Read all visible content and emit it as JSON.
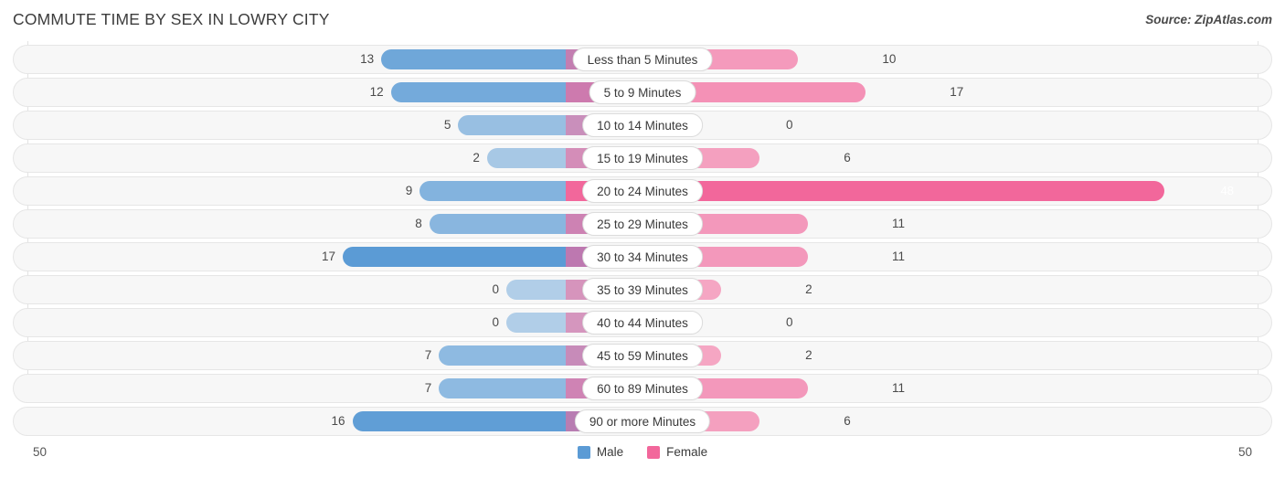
{
  "header": {
    "title": "COMMUTE TIME BY SEX IN LOWRY CITY",
    "source": "Source: ZipAtlas.com"
  },
  "axis": {
    "left_label": "50",
    "right_label": "50"
  },
  "legend": {
    "items": [
      {
        "label": "Male",
        "color": "#5b9bd5"
      },
      {
        "label": "Female",
        "color": "#f2679b"
      }
    ]
  },
  "colors": {
    "male": "#5b9bd5",
    "female": "#f2679b",
    "track": "#f7f7f7",
    "track_border": "#e6e6e6",
    "gridline": "#e2e2e2",
    "label_pill": "#ffffff"
  },
  "chart_data": {
    "type": "bar",
    "orientation": "horizontal",
    "layout": "diverging-bidirectional",
    "title": "COMMUTE TIME BY SEX IN LOWRY CITY",
    "xlabel": "",
    "ylabel": "",
    "xlim": [
      50,
      50
    ],
    "axis_max": 50,
    "grid": true,
    "legend_position": "bottom-center",
    "categories": [
      "Less than 5 Minutes",
      "5 to 9 Minutes",
      "10 to 14 Minutes",
      "15 to 19 Minutes",
      "20 to 24 Minutes",
      "25 to 29 Minutes",
      "30 to 34 Minutes",
      "35 to 39 Minutes",
      "40 to 44 Minutes",
      "45 to 59 Minutes",
      "60 to 89 Minutes",
      "90 or more Minutes"
    ],
    "series": [
      {
        "name": "Male",
        "color": "#5b9bd5",
        "direction": "left",
        "values": [
          13,
          12,
          5,
          2,
          9,
          8,
          17,
          0,
          0,
          7,
          7,
          16
        ]
      },
      {
        "name": "Female",
        "color": "#f2679b",
        "direction": "right",
        "values": [
          10,
          17,
          0,
          6,
          48,
          11,
          11,
          2,
          0,
          2,
          11,
          6
        ]
      }
    ]
  }
}
